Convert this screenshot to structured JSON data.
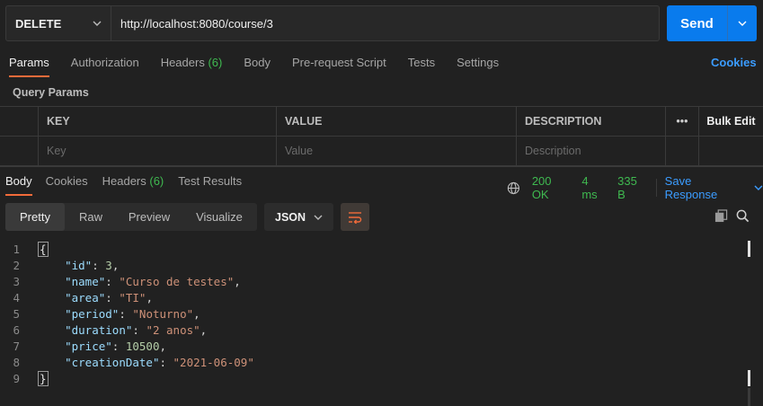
{
  "request": {
    "method": "DELETE",
    "url": "http://localhost:8080/course/3",
    "send_label": "Send"
  },
  "request_tabs": {
    "items": [
      {
        "label": "Params"
      },
      {
        "label": "Authorization"
      },
      {
        "label": "Headers",
        "count": "(6)"
      },
      {
        "label": "Body"
      },
      {
        "label": "Pre-request Script"
      },
      {
        "label": "Tests"
      },
      {
        "label": "Settings"
      }
    ],
    "cookies_link": "Cookies"
  },
  "query_params": {
    "title": "Query Params",
    "headers": {
      "key": "KEY",
      "value": "VALUE",
      "description": "DESCRIPTION",
      "more": "•••",
      "bulk_edit": "Bulk Edit"
    },
    "placeholders": {
      "key": "Key",
      "value": "Value",
      "description": "Description"
    }
  },
  "response_tabs": {
    "items": [
      {
        "label": "Body"
      },
      {
        "label": "Cookies"
      },
      {
        "label": "Headers",
        "count": "(6)"
      },
      {
        "label": "Test Results"
      }
    ]
  },
  "response_status": {
    "status": "200 OK",
    "time": "4 ms",
    "size": "335 B",
    "save_label": "Save Response"
  },
  "view_modes": {
    "items": [
      "Pretty",
      "Raw",
      "Preview",
      "Visualize"
    ],
    "format": "JSON"
  },
  "response_body": {
    "line_numbers": [
      "1",
      "2",
      "3",
      "4",
      "5",
      "6",
      "7",
      "8",
      "9"
    ],
    "open_brace": "{",
    "close_brace": "}",
    "fields": [
      {
        "key": "\"id\"",
        "value": "3",
        "kind": "n",
        "comma": ","
      },
      {
        "key": "\"name\"",
        "value": "\"Curso de testes\"",
        "kind": "s",
        "comma": ","
      },
      {
        "key": "\"area\"",
        "value": "\"TI\"",
        "kind": "s",
        "comma": ","
      },
      {
        "key": "\"period\"",
        "value": "\"Noturno\"",
        "kind": "s",
        "comma": ","
      },
      {
        "key": "\"duration\"",
        "value": "\"2 anos\"",
        "kind": "s",
        "comma": ","
      },
      {
        "key": "\"price\"",
        "value": "10500",
        "kind": "n",
        "comma": ","
      },
      {
        "key": "\"creationDate\"",
        "value": "\"2021-06-09\"",
        "kind": "s",
        "comma": ""
      }
    ]
  },
  "colors": {
    "accent": "#f26b3a",
    "send_button": "#097bed",
    "status_green": "#3fb950",
    "link_blue": "#3b9cff"
  },
  "icons": {
    "method_caret": "chevron-down-icon",
    "send_caret": "chevron-down-icon",
    "globe": "globe-icon",
    "wrap": "wrap-lines-icon",
    "copy": "copy-icon",
    "search": "search-icon"
  }
}
